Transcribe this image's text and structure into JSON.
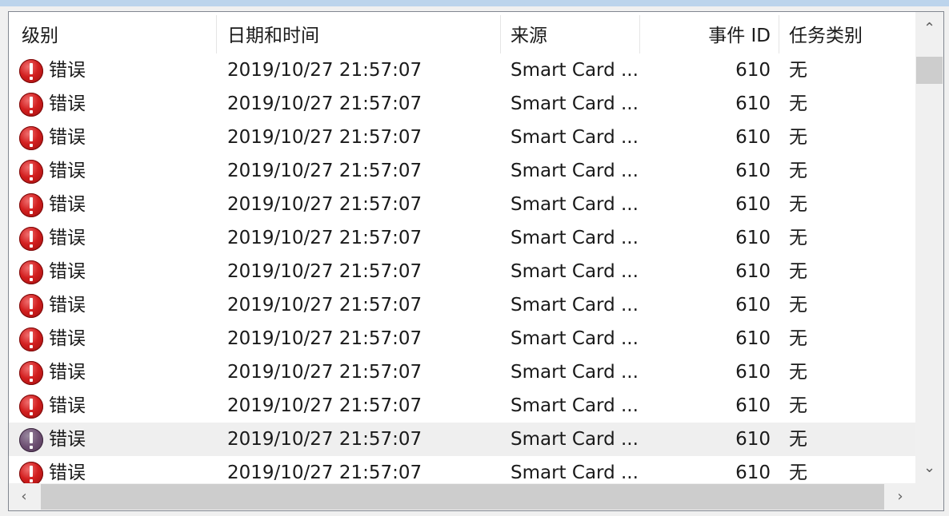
{
  "columns": {
    "level": "级别",
    "datetime": "日期和时间",
    "source": "来源",
    "event_id": "事件 ID",
    "task_category": "任务类别"
  },
  "rows": [
    {
      "level": "错误",
      "datetime": "2019/10/27 21:57:07",
      "source": "Smart Card ...",
      "event_id": "610",
      "task": "无"
    },
    {
      "level": "错误",
      "datetime": "2019/10/27 21:57:07",
      "source": "Smart Card ...",
      "event_id": "610",
      "task": "无"
    },
    {
      "level": "错误",
      "datetime": "2019/10/27 21:57:07",
      "source": "Smart Card ...",
      "event_id": "610",
      "task": "无"
    },
    {
      "level": "错误",
      "datetime": "2019/10/27 21:57:07",
      "source": "Smart Card ...",
      "event_id": "610",
      "task": "无"
    },
    {
      "level": "错误",
      "datetime": "2019/10/27 21:57:07",
      "source": "Smart Card ...",
      "event_id": "610",
      "task": "无"
    },
    {
      "level": "错误",
      "datetime": "2019/10/27 21:57:07",
      "source": "Smart Card ...",
      "event_id": "610",
      "task": "无"
    },
    {
      "level": "错误",
      "datetime": "2019/10/27 21:57:07",
      "source": "Smart Card ...",
      "event_id": "610",
      "task": "无"
    },
    {
      "level": "错误",
      "datetime": "2019/10/27 21:57:07",
      "source": "Smart Card ...",
      "event_id": "610",
      "task": "无"
    },
    {
      "level": "错误",
      "datetime": "2019/10/27 21:57:07",
      "source": "Smart Card ...",
      "event_id": "610",
      "task": "无"
    },
    {
      "level": "错误",
      "datetime": "2019/10/27 21:57:07",
      "source": "Smart Card ...",
      "event_id": "610",
      "task": "无"
    },
    {
      "level": "错误",
      "datetime": "2019/10/27 21:57:07",
      "source": "Smart Card ...",
      "event_id": "610",
      "task": "无"
    },
    {
      "level": "错误",
      "datetime": "2019/10/27 21:57:07",
      "source": "Smart Card ...",
      "event_id": "610",
      "task": "无",
      "selected": true
    },
    {
      "level": "错误",
      "datetime": "2019/10/27 21:57:07",
      "source": "Smart Card ...",
      "event_id": "610",
      "task": "无"
    }
  ],
  "icons": {
    "row_level": "error-icon",
    "scroll_up": "chevron-up-icon",
    "scroll_down": "chevron-down-icon",
    "scroll_left": "chevron-left-icon",
    "scroll_right": "chevron-right-icon"
  },
  "colors": {
    "error_icon": "#d21f1f",
    "selected_row": "#efefef",
    "scrollbar_thumb": "#cdcdcd"
  }
}
